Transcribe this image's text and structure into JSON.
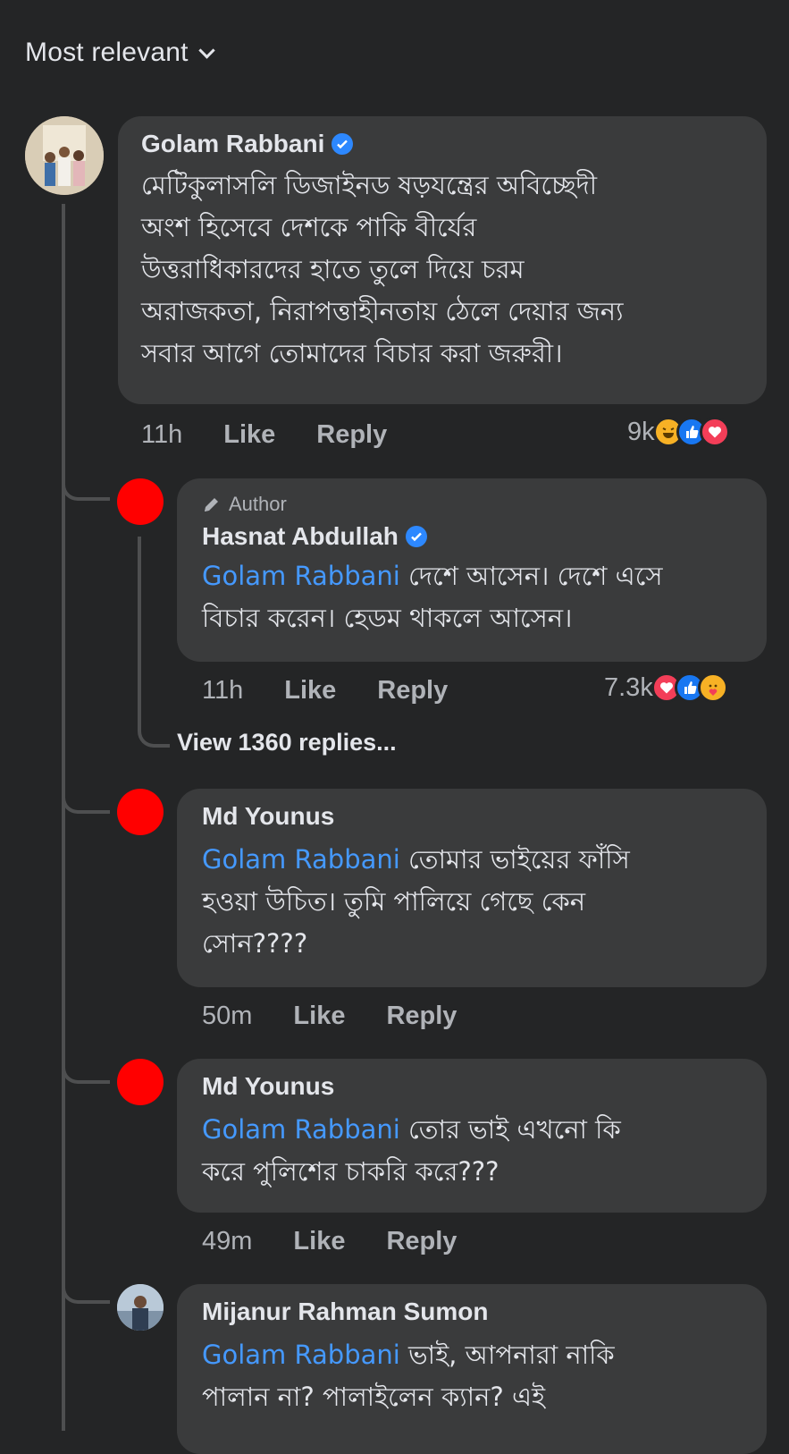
{
  "sort": {
    "label": "Most relevant"
  },
  "comments": [
    {
      "author": "Golam Rabbani",
      "verified": true,
      "text_lines": [
        "মেটিকুলাসলি ডিজাইনড ষড়যন্ত্রের অবিচ্ছেদী",
        "অংশ হিসেবে দেশকে পাকি বীর্যের",
        "উত্তরাধিকারদের হাতে তুলে দিয়ে চরম",
        "অরাজকতা, নিরাপত্তাহীনতায় ঠেলে দেয়ার জন্য",
        "সবার আগে তোমাদের বিচার করা জরুরী।"
      ],
      "time": "11h",
      "like": "Like",
      "reply": "Reply",
      "reaction_count": "9k",
      "reactions": [
        "haha",
        "like",
        "love"
      ]
    }
  ],
  "replies": [
    {
      "badge": "Author",
      "author": "Hasnat Abdullah",
      "verified": true,
      "mention": "Golam Rabbani",
      "text_first": " দেশে আসেন। দেশে এসে",
      "text_lines": [
        "বিচার করেন। হেডম থাকলে আসেন।"
      ],
      "time": "11h",
      "like": "Like",
      "reply": "Reply",
      "reaction_count": "7.3k",
      "reactions": [
        "love",
        "like",
        "care"
      ],
      "view_replies": "View 1360 replies..."
    },
    {
      "author": "Md Younus",
      "mention": "Golam Rabbani",
      "text_first": " তোমার ভাইয়ের ফাঁসি",
      "text_lines": [
        "হওয়া উচিত।  তুমি পালিয়ে গেছে কেন",
        "সোন????"
      ],
      "time": "50m",
      "like": "Like",
      "reply": "Reply"
    },
    {
      "author": "Md Younus",
      "mention": "Golam Rabbani",
      "text_first": " তোর ভাই এখনো কি",
      "text_lines": [
        "করে পুলিশের চাকরি করে???"
      ],
      "time": "49m",
      "like": "Like",
      "reply": "Reply"
    },
    {
      "author": "Mijanur Rahman Sumon",
      "mention": "Golam Rabbani",
      "text_first": " ভাই, আপনারা নাকি",
      "text_lines": [
        "পালান না?  পালাইলেন ক্যান? এই"
      ]
    }
  ],
  "colors": {
    "background": "#242526",
    "bubble": "#3a3b3c",
    "mention": "#4599ff",
    "verified": "#2d88ff",
    "red_avatar": "#ff0000"
  }
}
